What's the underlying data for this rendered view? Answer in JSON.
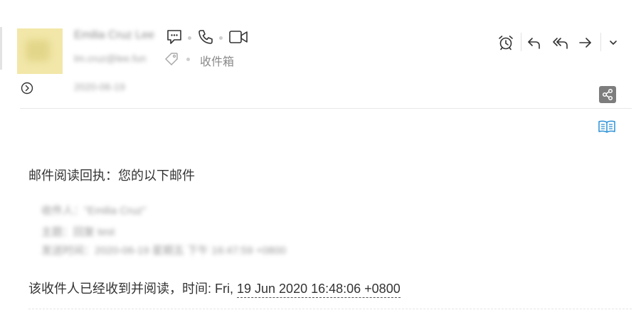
{
  "sender": {
    "name": "Emilia Cruz Lee",
    "address": "lm.cruz@lee.fun",
    "date": "2020-06-19",
    "folder": "收件箱"
  },
  "body": {
    "heading": "邮件阅读回执：您的以下邮件",
    "quoted_lines": [
      "收件人：\"Emilia Cruz\"",
      "主题：回复 test",
      "发送时间：2020-06-19 星期五 下午 16:47:59 +0800"
    ],
    "read_prefix": "该收件人已经收到并阅读，时间: Fri, ",
    "read_time": "19 Jun 2020 16:48:06 +0800"
  },
  "colors": {
    "icon": "#333333",
    "accent": "#2a90d6",
    "muted": "#8a8a8a",
    "avatar_bg": "#f2e7a8",
    "share_bg": "#7d7d7d"
  },
  "icons": {
    "chat": "chat-bubble-icon",
    "phone": "phone-icon",
    "video": "video-camera-icon",
    "tag": "tag-icon",
    "expand": "chevron-right-circle-icon",
    "alarm": "alarm-clock-icon",
    "reply": "reply-icon",
    "reply_all": "reply-all-icon",
    "forward": "forward-icon",
    "more": "chevron-down-icon",
    "share": "share-icon",
    "reader": "reading-mode-icon"
  }
}
